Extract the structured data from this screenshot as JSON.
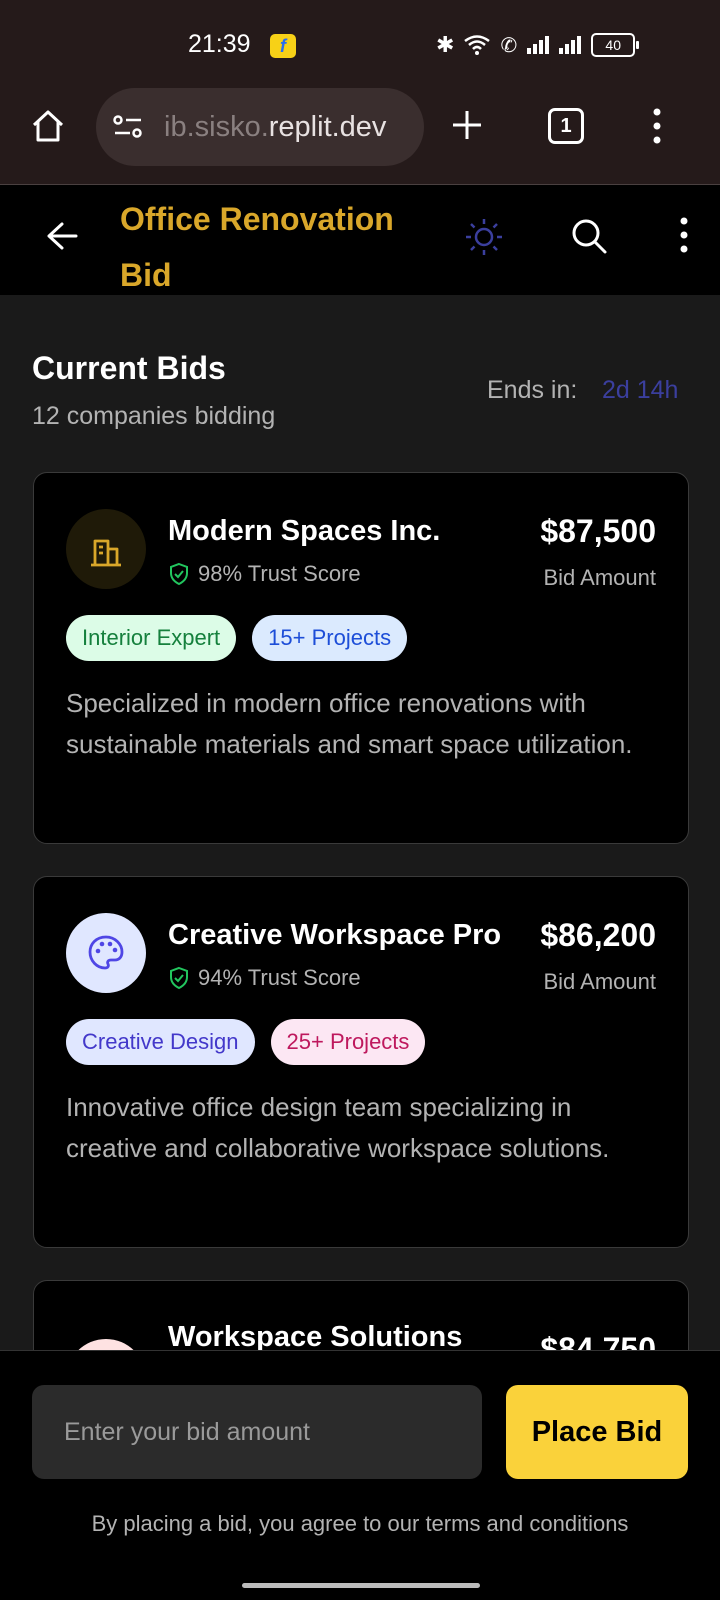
{
  "status_bar": {
    "time": "21:39",
    "battery": "40"
  },
  "browser": {
    "url_faded": "ib.sisko.",
    "url_main": "replit.dev",
    "tab_count": "1"
  },
  "header": {
    "title": "Office Renovation Bid"
  },
  "bids_section": {
    "heading": "Current Bids",
    "count_text": "12 companies bidding",
    "ends_label": "Ends in:",
    "ends_value": "2d 14h"
  },
  "bids": [
    {
      "company": "Modern Spaces Inc.",
      "trust": "98% Trust Score",
      "amount": "$87,500",
      "amount_label": "Bid Amount",
      "icon": "building-icon",
      "tags": [
        "Interior Expert",
        "15+ Projects"
      ],
      "description": "Specialized in modern office renovations with sustainable materials and smart space utilization."
    },
    {
      "company": "Creative Workspace Pro",
      "trust": "94% Trust Score",
      "amount": "$86,200",
      "amount_label": "Bid Amount",
      "icon": "palette-icon",
      "tags": [
        "Creative Design",
        "25+ Projects"
      ],
      "description": "Innovative office design team specializing in creative and collaborative workspace solutions."
    },
    {
      "company": "Workspace Solutions",
      "amount": "$84,750"
    }
  ],
  "bid_form": {
    "placeholder": "Enter your bid amount",
    "button_label": "Place Bid",
    "terms": "By placing a bid, you agree to our terms and conditions"
  },
  "colors": {
    "accent_yellow": "#fad23a",
    "title_gold": "#d9a72a",
    "ends_blue": "#3b3f9e",
    "trust_green": "#22c55e"
  }
}
